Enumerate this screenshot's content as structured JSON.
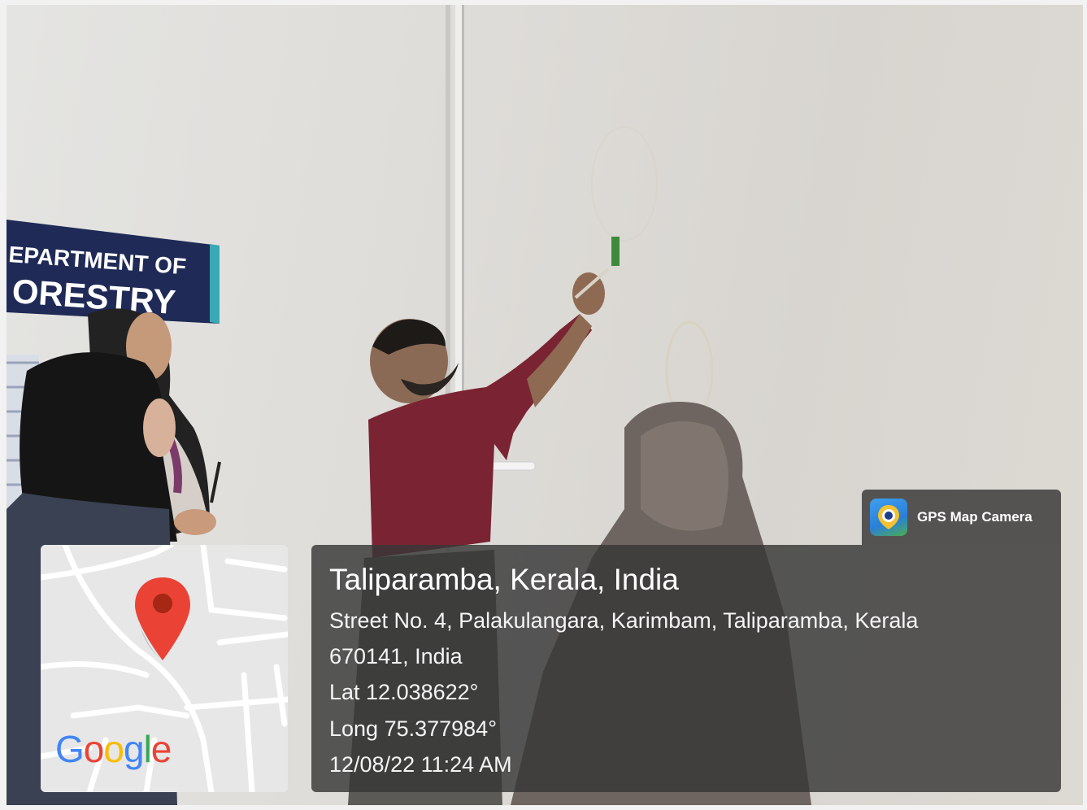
{
  "photo": {
    "banner_line1": "EPARTMENT OF",
    "banner_line2": "ORESTRY"
  },
  "gps_badge": {
    "icon": "gps-camera-app-icon",
    "label": "GPS Map Camera"
  },
  "map": {
    "pin_icon": "map-pin-icon",
    "logo_letters": [
      "G",
      "o",
      "o",
      "g",
      "l",
      "e"
    ],
    "logo_colors": [
      "#4285F4",
      "#EA4335",
      "#FBBC05",
      "#4285F4",
      "#34A853",
      "#EA4335"
    ]
  },
  "location": {
    "title": "Taliparamba, Kerala, India",
    "address_line1": "Street No. 4, Palakulangara, Karimbam, Taliparamba, Kerala",
    "address_line2": "670141, India",
    "lat": "Lat 12.038622°",
    "long": "Long 75.377984°",
    "datetime": "12/08/22 11:24 AM"
  }
}
